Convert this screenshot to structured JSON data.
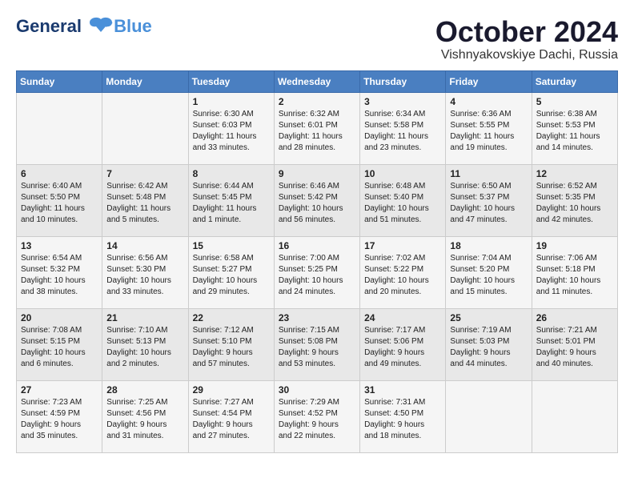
{
  "header": {
    "logo_line1": "General",
    "logo_line2": "Blue",
    "month_title": "October 2024",
    "location": "Vishnyakovskiye Dachi, Russia"
  },
  "weekdays": [
    "Sunday",
    "Monday",
    "Tuesday",
    "Wednesday",
    "Thursday",
    "Friday",
    "Saturday"
  ],
  "weeks": [
    [
      {
        "day": "",
        "info": ""
      },
      {
        "day": "",
        "info": ""
      },
      {
        "day": "1",
        "info": "Sunrise: 6:30 AM\nSunset: 6:03 PM\nDaylight: 11 hours\nand 33 minutes."
      },
      {
        "day": "2",
        "info": "Sunrise: 6:32 AM\nSunset: 6:01 PM\nDaylight: 11 hours\nand 28 minutes."
      },
      {
        "day": "3",
        "info": "Sunrise: 6:34 AM\nSunset: 5:58 PM\nDaylight: 11 hours\nand 23 minutes."
      },
      {
        "day": "4",
        "info": "Sunrise: 6:36 AM\nSunset: 5:55 PM\nDaylight: 11 hours\nand 19 minutes."
      },
      {
        "day": "5",
        "info": "Sunrise: 6:38 AM\nSunset: 5:53 PM\nDaylight: 11 hours\nand 14 minutes."
      }
    ],
    [
      {
        "day": "6",
        "info": "Sunrise: 6:40 AM\nSunset: 5:50 PM\nDaylight: 11 hours\nand 10 minutes."
      },
      {
        "day": "7",
        "info": "Sunrise: 6:42 AM\nSunset: 5:48 PM\nDaylight: 11 hours\nand 5 minutes."
      },
      {
        "day": "8",
        "info": "Sunrise: 6:44 AM\nSunset: 5:45 PM\nDaylight: 11 hours\nand 1 minute."
      },
      {
        "day": "9",
        "info": "Sunrise: 6:46 AM\nSunset: 5:42 PM\nDaylight: 10 hours\nand 56 minutes."
      },
      {
        "day": "10",
        "info": "Sunrise: 6:48 AM\nSunset: 5:40 PM\nDaylight: 10 hours\nand 51 minutes."
      },
      {
        "day": "11",
        "info": "Sunrise: 6:50 AM\nSunset: 5:37 PM\nDaylight: 10 hours\nand 47 minutes."
      },
      {
        "day": "12",
        "info": "Sunrise: 6:52 AM\nSunset: 5:35 PM\nDaylight: 10 hours\nand 42 minutes."
      }
    ],
    [
      {
        "day": "13",
        "info": "Sunrise: 6:54 AM\nSunset: 5:32 PM\nDaylight: 10 hours\nand 38 minutes."
      },
      {
        "day": "14",
        "info": "Sunrise: 6:56 AM\nSunset: 5:30 PM\nDaylight: 10 hours\nand 33 minutes."
      },
      {
        "day": "15",
        "info": "Sunrise: 6:58 AM\nSunset: 5:27 PM\nDaylight: 10 hours\nand 29 minutes."
      },
      {
        "day": "16",
        "info": "Sunrise: 7:00 AM\nSunset: 5:25 PM\nDaylight: 10 hours\nand 24 minutes."
      },
      {
        "day": "17",
        "info": "Sunrise: 7:02 AM\nSunset: 5:22 PM\nDaylight: 10 hours\nand 20 minutes."
      },
      {
        "day": "18",
        "info": "Sunrise: 7:04 AM\nSunset: 5:20 PM\nDaylight: 10 hours\nand 15 minutes."
      },
      {
        "day": "19",
        "info": "Sunrise: 7:06 AM\nSunset: 5:18 PM\nDaylight: 10 hours\nand 11 minutes."
      }
    ],
    [
      {
        "day": "20",
        "info": "Sunrise: 7:08 AM\nSunset: 5:15 PM\nDaylight: 10 hours\nand 6 minutes."
      },
      {
        "day": "21",
        "info": "Sunrise: 7:10 AM\nSunset: 5:13 PM\nDaylight: 10 hours\nand 2 minutes."
      },
      {
        "day": "22",
        "info": "Sunrise: 7:12 AM\nSunset: 5:10 PM\nDaylight: 9 hours\nand 57 minutes."
      },
      {
        "day": "23",
        "info": "Sunrise: 7:15 AM\nSunset: 5:08 PM\nDaylight: 9 hours\nand 53 minutes."
      },
      {
        "day": "24",
        "info": "Sunrise: 7:17 AM\nSunset: 5:06 PM\nDaylight: 9 hours\nand 49 minutes."
      },
      {
        "day": "25",
        "info": "Sunrise: 7:19 AM\nSunset: 5:03 PM\nDaylight: 9 hours\nand 44 minutes."
      },
      {
        "day": "26",
        "info": "Sunrise: 7:21 AM\nSunset: 5:01 PM\nDaylight: 9 hours\nand 40 minutes."
      }
    ],
    [
      {
        "day": "27",
        "info": "Sunrise: 7:23 AM\nSunset: 4:59 PM\nDaylight: 9 hours\nand 35 minutes."
      },
      {
        "day": "28",
        "info": "Sunrise: 7:25 AM\nSunset: 4:56 PM\nDaylight: 9 hours\nand 31 minutes."
      },
      {
        "day": "29",
        "info": "Sunrise: 7:27 AM\nSunset: 4:54 PM\nDaylight: 9 hours\nand 27 minutes."
      },
      {
        "day": "30",
        "info": "Sunrise: 7:29 AM\nSunset: 4:52 PM\nDaylight: 9 hours\nand 22 minutes."
      },
      {
        "day": "31",
        "info": "Sunrise: 7:31 AM\nSunset: 4:50 PM\nDaylight: 9 hours\nand 18 minutes."
      },
      {
        "day": "",
        "info": ""
      },
      {
        "day": "",
        "info": ""
      }
    ]
  ]
}
